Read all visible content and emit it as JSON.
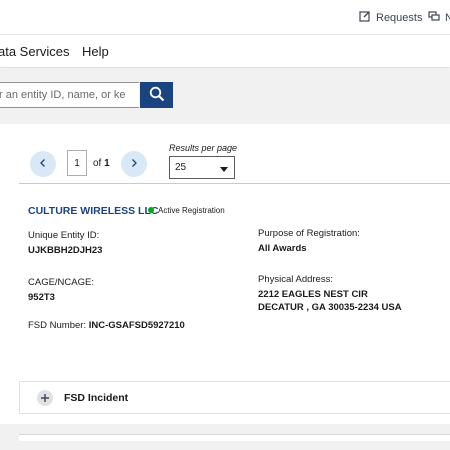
{
  "header": {
    "requests_label": "Requests",
    "notifications_label": "N"
  },
  "nav": {
    "data_services_label": "ata Services",
    "help_label": "Help"
  },
  "search": {
    "placeholder": "r an entity ID, name, or ke"
  },
  "pagination": {
    "current_page": "1",
    "of_label": "of",
    "total_pages": "1",
    "results_per_page_label": "Results per page",
    "results_per_page_value": "25"
  },
  "entity": {
    "name": "CULTURE WIRELESS LLC",
    "status": "Active Registration",
    "uei_label": "Unique Entity ID:",
    "uei_value": "UJKBBH2DJH23",
    "cage_label": "CAGE/NCAGE:",
    "cage_value": "952T3",
    "fsd_label": "FSD Number:",
    "fsd_value": "INC-GSAFSD5927210",
    "purpose_label": "Purpose of Registration:",
    "purpose_value": "All Awards",
    "address_label": "Physical Address:",
    "address_line1": "2212 EAGLES NEST CIR",
    "address_line2": "DECATUR , GA 30035-2234 USA"
  },
  "accordion": {
    "label": "FSD Incident"
  },
  "colors": {
    "primary": "#1a4480",
    "active_green": "#00a91c",
    "pager_bg": "#d9e8f6"
  }
}
